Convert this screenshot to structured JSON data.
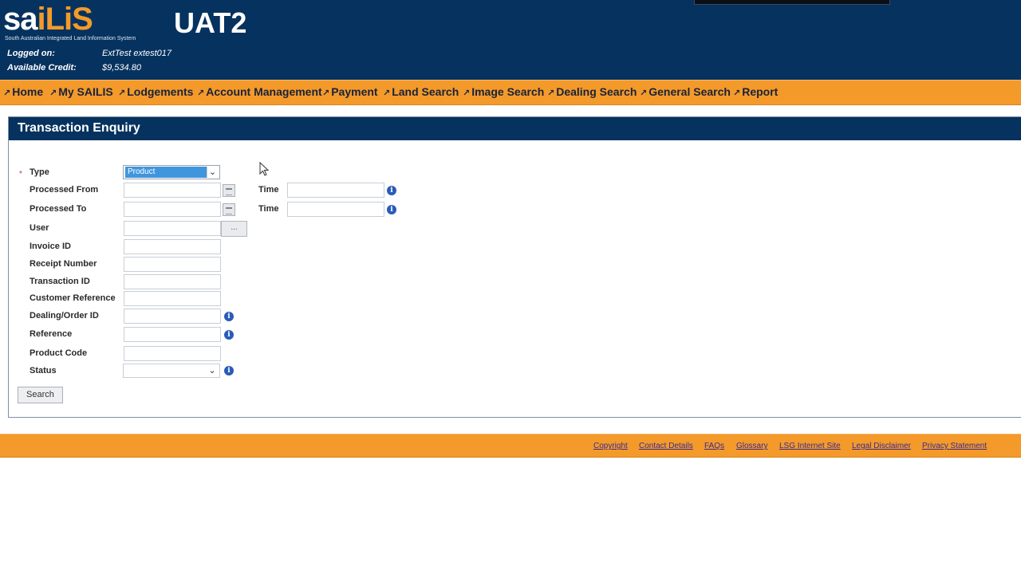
{
  "header": {
    "logo_part1": "sa",
    "logo_part2": "iLiS",
    "tagline": "South Australian Integrated Land Information System",
    "environment": "UAT2",
    "logged_on_label": "Logged on:",
    "logged_on_value": "ExtTest extest017",
    "credit_label": "Available Credit:",
    "credit_value": "$9,534.80"
  },
  "nav": {
    "items": [
      "Home",
      "My SAILIS",
      "Lodgements",
      "Account Management",
      "Payment",
      "Land Search",
      "Image Search",
      "Dealing Search",
      "General Search",
      "Report"
    ],
    "arrow_glyph": "↗"
  },
  "form": {
    "title": "Transaction Enquiry",
    "required_marker": "*",
    "type_label": "Type",
    "type_value": "Product",
    "processed_from_label": "Processed From",
    "processed_to_label": "Processed To",
    "time_label": "Time",
    "user_label": "User",
    "user_button": "...",
    "invoice_label": "Invoice ID",
    "receipt_label": "Receipt Number",
    "transaction_label": "Transaction ID",
    "customer_ref_label": "Customer Reference",
    "dealing_label": "Dealing/Order ID",
    "reference_label": "Reference",
    "product_code_label": "Product Code",
    "status_label": "Status",
    "status_value": "",
    "search_button": "Search",
    "info_glyph": "i"
  },
  "footer": {
    "links": [
      "Copyright",
      "Contact Details",
      "FAQs",
      "Glossary",
      "LSG Internet Site",
      "Legal Disclaimer",
      "Privacy Statement"
    ]
  },
  "colors": {
    "header_bg": "#06325f",
    "accent_orange": "#f39a2b",
    "select_highlight": "#3f96dd",
    "info_blue": "#2a5bb8"
  }
}
